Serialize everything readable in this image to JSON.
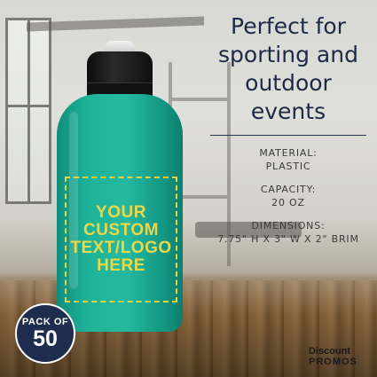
{
  "headline_lines": [
    "Perfect for",
    "sporting and",
    "outdoor",
    "events"
  ],
  "specs": [
    {
      "label": "MATERIAL:",
      "value": "PLASTIC"
    },
    {
      "label": "CAPACITY:",
      "value": "20 OZ"
    },
    {
      "label": "DIMENSIONS:",
      "value": "7.75\" H X 3\" W X 2\" BRIM"
    }
  ],
  "imprint_lines": [
    "YOUR",
    "CUSTOM",
    "TEXT/LOGO",
    "HERE"
  ],
  "badge": {
    "top": "PACK OF",
    "number": "50"
  },
  "logo": {
    "line1": "Discount",
    "line2": "PROMOS"
  },
  "colors": {
    "bottle": "#1fb39a",
    "cap": "#111111",
    "imprint": "#e9d84a",
    "headline": "#1c2a45",
    "badge": "#1e2d4d"
  }
}
